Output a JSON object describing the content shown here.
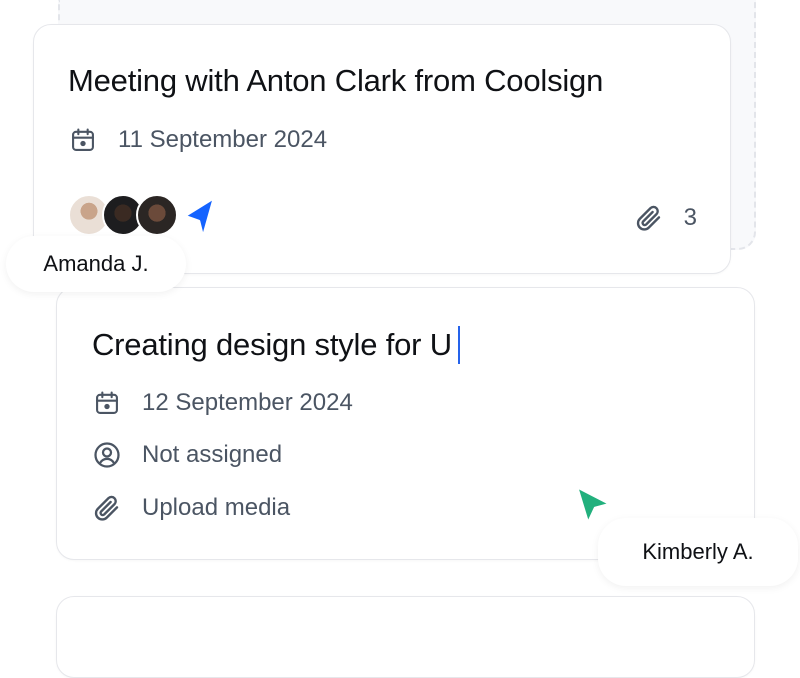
{
  "cards": [
    {
      "title": "Meeting with Anton Clark from Coolsign",
      "date": "11 September 2024",
      "attachments_count": "3",
      "avatars": [
        "avatar",
        "avatar",
        "avatar"
      ]
    },
    {
      "title": "Creating design style for U",
      "date": "12 September 2024",
      "assignee": "Not assigned",
      "media": "Upload media"
    }
  ],
  "cursors": {
    "amanda": {
      "name": "Amanda J.",
      "color": "#1463ff"
    },
    "kimberly": {
      "name": "Kimberly A.",
      "color": "#22b07d"
    }
  },
  "icons": {
    "calendar": "calendar-icon",
    "user": "user-circle-icon",
    "paperclip": "paperclip-icon"
  },
  "colors": {
    "caret": "#2563eb",
    "text_muted": "#4b5563"
  }
}
